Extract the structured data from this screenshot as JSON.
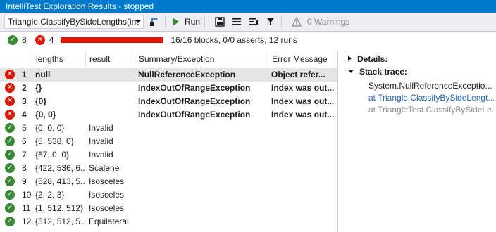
{
  "window": {
    "title": "IntelliTest Exploration Results - stopped"
  },
  "toolbar": {
    "method": "Triangle.ClassifyBySideLengths(int",
    "run_label": "Run",
    "warnings_label": "0 Warnings",
    "icons": [
      "go-to-icon",
      "run-icon",
      "save-icon",
      "list-icon",
      "export-icon",
      "filter-icon",
      "warning-icon"
    ]
  },
  "summary": {
    "passed": "8",
    "failed": "4",
    "progress_percent": 100,
    "status": "16/16 blocks, 0/0 asserts, 12 runs"
  },
  "grid": {
    "columns": [
      "lengths",
      "result",
      "Summary/Exception",
      "Error Message"
    ],
    "rows": [
      {
        "status": "fail",
        "num": "1",
        "lengths": "null",
        "result": "",
        "summary": "NullReferenceException",
        "error": "Object refer..."
      },
      {
        "status": "fail",
        "num": "2",
        "lengths": "{}",
        "result": "",
        "summary": "IndexOutOfRangeException",
        "error": "Index was out..."
      },
      {
        "status": "fail",
        "num": "3",
        "lengths": "{0}",
        "result": "",
        "summary": "IndexOutOfRangeException",
        "error": "Index was out..."
      },
      {
        "status": "fail",
        "num": "4",
        "lengths": "{0, 0}",
        "result": "",
        "summary": "IndexOutOfRangeException",
        "error": "Index was out..."
      },
      {
        "status": "pass",
        "num": "5",
        "lengths": "{0, 0, 0}",
        "result": "Invalid",
        "summary": "",
        "error": ""
      },
      {
        "status": "pass",
        "num": "6",
        "lengths": "{5, 538, 0}",
        "result": "Invalid",
        "summary": "",
        "error": ""
      },
      {
        "status": "pass",
        "num": "7",
        "lengths": "{67, 0, 0}",
        "result": "Invalid",
        "summary": "",
        "error": ""
      },
      {
        "status": "pass",
        "num": "8",
        "lengths": "{422, 536, 6...",
        "result": "Scalene",
        "summary": "",
        "error": ""
      },
      {
        "status": "pass",
        "num": "9",
        "lengths": "{528, 413, 5...",
        "result": "Isosceles",
        "summary": "",
        "error": ""
      },
      {
        "status": "pass",
        "num": "10",
        "lengths": "{2, 2, 3}",
        "result": "Isosceles",
        "summary": "",
        "error": ""
      },
      {
        "status": "pass",
        "num": "11",
        "lengths": "{1, 512, 512}",
        "result": "Isosceles",
        "summary": "",
        "error": ""
      },
      {
        "status": "pass",
        "num": "12",
        "lengths": "{512, 512, 5...",
        "result": "Equilateral",
        "summary": "",
        "error": ""
      }
    ]
  },
  "details": {
    "details_label": "Details:",
    "stack_label": "Stack trace:",
    "trace": [
      {
        "text": "System.NullReferenceExceptio...",
        "kind": "plain"
      },
      {
        "text": "at Triangle.ClassifyBySideLengt...",
        "kind": "link"
      },
      {
        "text": "at TriangleTest.ClassifyBySideLe...",
        "kind": "gray"
      }
    ]
  },
  "colors": {
    "accent": "#007acc",
    "pass": "#388a34",
    "fail": "#e51400",
    "link": "#1e62c9",
    "gray": "#8a8a8a"
  }
}
